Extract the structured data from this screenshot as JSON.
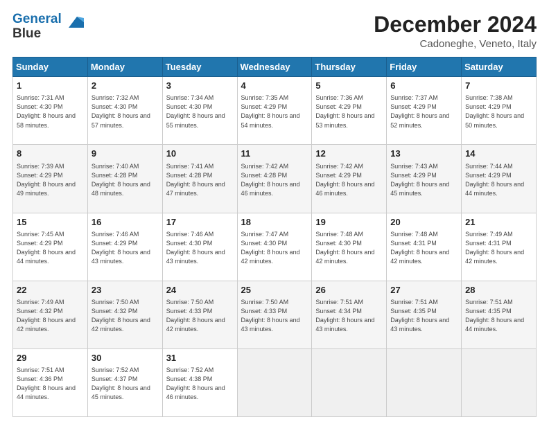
{
  "header": {
    "logo_line1": "General",
    "logo_line2": "Blue",
    "month": "December 2024",
    "location": "Cadoneghe, Veneto, Italy"
  },
  "days_of_week": [
    "Sunday",
    "Monday",
    "Tuesday",
    "Wednesday",
    "Thursday",
    "Friday",
    "Saturday"
  ],
  "weeks": [
    [
      {
        "day": "1",
        "sunrise": "7:31 AM",
        "sunset": "4:30 PM",
        "daylight": "8 hours and 58 minutes."
      },
      {
        "day": "2",
        "sunrise": "7:32 AM",
        "sunset": "4:30 PM",
        "daylight": "8 hours and 57 minutes."
      },
      {
        "day": "3",
        "sunrise": "7:34 AM",
        "sunset": "4:30 PM",
        "daylight": "8 hours and 55 minutes."
      },
      {
        "day": "4",
        "sunrise": "7:35 AM",
        "sunset": "4:29 PM",
        "daylight": "8 hours and 54 minutes."
      },
      {
        "day": "5",
        "sunrise": "7:36 AM",
        "sunset": "4:29 PM",
        "daylight": "8 hours and 53 minutes."
      },
      {
        "day": "6",
        "sunrise": "7:37 AM",
        "sunset": "4:29 PM",
        "daylight": "8 hours and 52 minutes."
      },
      {
        "day": "7",
        "sunrise": "7:38 AM",
        "sunset": "4:29 PM",
        "daylight": "8 hours and 50 minutes."
      }
    ],
    [
      {
        "day": "8",
        "sunrise": "7:39 AM",
        "sunset": "4:29 PM",
        "daylight": "8 hours and 49 minutes."
      },
      {
        "day": "9",
        "sunrise": "7:40 AM",
        "sunset": "4:28 PM",
        "daylight": "8 hours and 48 minutes."
      },
      {
        "day": "10",
        "sunrise": "7:41 AM",
        "sunset": "4:28 PM",
        "daylight": "8 hours and 47 minutes."
      },
      {
        "day": "11",
        "sunrise": "7:42 AM",
        "sunset": "4:28 PM",
        "daylight": "8 hours and 46 minutes."
      },
      {
        "day": "12",
        "sunrise": "7:42 AM",
        "sunset": "4:29 PM",
        "daylight": "8 hours and 46 minutes."
      },
      {
        "day": "13",
        "sunrise": "7:43 AM",
        "sunset": "4:29 PM",
        "daylight": "8 hours and 45 minutes."
      },
      {
        "day": "14",
        "sunrise": "7:44 AM",
        "sunset": "4:29 PM",
        "daylight": "8 hours and 44 minutes."
      }
    ],
    [
      {
        "day": "15",
        "sunrise": "7:45 AM",
        "sunset": "4:29 PM",
        "daylight": "8 hours and 44 minutes."
      },
      {
        "day": "16",
        "sunrise": "7:46 AM",
        "sunset": "4:29 PM",
        "daylight": "8 hours and 43 minutes."
      },
      {
        "day": "17",
        "sunrise": "7:46 AM",
        "sunset": "4:30 PM",
        "daylight": "8 hours and 43 minutes."
      },
      {
        "day": "18",
        "sunrise": "7:47 AM",
        "sunset": "4:30 PM",
        "daylight": "8 hours and 42 minutes."
      },
      {
        "day": "19",
        "sunrise": "7:48 AM",
        "sunset": "4:30 PM",
        "daylight": "8 hours and 42 minutes."
      },
      {
        "day": "20",
        "sunrise": "7:48 AM",
        "sunset": "4:31 PM",
        "daylight": "8 hours and 42 minutes."
      },
      {
        "day": "21",
        "sunrise": "7:49 AM",
        "sunset": "4:31 PM",
        "daylight": "8 hours and 42 minutes."
      }
    ],
    [
      {
        "day": "22",
        "sunrise": "7:49 AM",
        "sunset": "4:32 PM",
        "daylight": "8 hours and 42 minutes."
      },
      {
        "day": "23",
        "sunrise": "7:50 AM",
        "sunset": "4:32 PM",
        "daylight": "8 hours and 42 minutes."
      },
      {
        "day": "24",
        "sunrise": "7:50 AM",
        "sunset": "4:33 PM",
        "daylight": "8 hours and 42 minutes."
      },
      {
        "day": "25",
        "sunrise": "7:50 AM",
        "sunset": "4:33 PM",
        "daylight": "8 hours and 43 minutes."
      },
      {
        "day": "26",
        "sunrise": "7:51 AM",
        "sunset": "4:34 PM",
        "daylight": "8 hours and 43 minutes."
      },
      {
        "day": "27",
        "sunrise": "7:51 AM",
        "sunset": "4:35 PM",
        "daylight": "8 hours and 43 minutes."
      },
      {
        "day": "28",
        "sunrise": "7:51 AM",
        "sunset": "4:35 PM",
        "daylight": "8 hours and 44 minutes."
      }
    ],
    [
      {
        "day": "29",
        "sunrise": "7:51 AM",
        "sunset": "4:36 PM",
        "daylight": "8 hours and 44 minutes."
      },
      {
        "day": "30",
        "sunrise": "7:52 AM",
        "sunset": "4:37 PM",
        "daylight": "8 hours and 45 minutes."
      },
      {
        "day": "31",
        "sunrise": "7:52 AM",
        "sunset": "4:38 PM",
        "daylight": "8 hours and 46 minutes."
      },
      null,
      null,
      null,
      null
    ]
  ],
  "labels": {
    "sunrise": "Sunrise:",
    "sunset": "Sunset:",
    "daylight": "Daylight:"
  }
}
